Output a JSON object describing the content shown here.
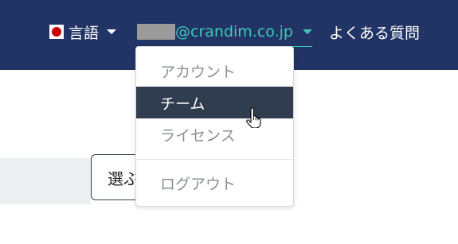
{
  "navbar": {
    "language_label": "言語",
    "account_email_suffix": "@crandim.co.jp",
    "faq_label": "よくある質問"
  },
  "account_menu": {
    "items": [
      {
        "label": "アカウント"
      },
      {
        "label": "チーム"
      },
      {
        "label": "ライセンス"
      },
      {
        "label": "ログアウト"
      }
    ],
    "active_index": 1
  },
  "main": {
    "select_button_label": "選ぶ"
  },
  "colors": {
    "navbar_bg": "#213465",
    "accent": "#3ec9b4",
    "menu_active_bg": "#2f3d4f"
  },
  "icons": {
    "flag": "japan-flag-icon",
    "cursor": "hand-pointer-icon"
  }
}
